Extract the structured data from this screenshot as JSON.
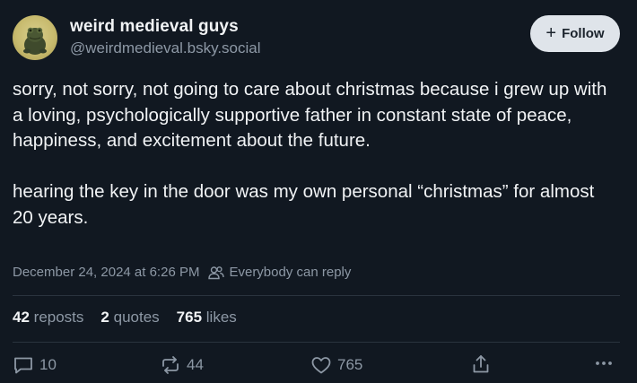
{
  "author": {
    "display_name": "weird medieval guys",
    "handle": "@weirdmedieval.bsky.social",
    "avatar_icon": "frog-avatar"
  },
  "follow_button": {
    "label": "Follow",
    "icon": "plus-icon"
  },
  "post": {
    "paragraphs": [
      "sorry, not sorry, not going to care about christmas because i grew up with a loving, psychologically supportive father in constant state of peace, happiness, and excitement about the future.",
      "hearing the key in the door was my own personal “christmas” for almost 20 years."
    ],
    "timestamp": "December 24, 2024 at 6:26 PM",
    "reply_setting": "Everybody can reply"
  },
  "stats": {
    "reposts": {
      "count": "42",
      "label": "reposts"
    },
    "quotes": {
      "count": "2",
      "label": "quotes"
    },
    "likes": {
      "count": "765",
      "label": "likes"
    }
  },
  "actions": {
    "reply": {
      "count": "10",
      "icon": "comment-icon"
    },
    "repost": {
      "count": "44",
      "icon": "repost-icon"
    },
    "like": {
      "count": "765",
      "icon": "heart-icon"
    },
    "share": {
      "icon": "share-icon"
    },
    "more": {
      "icon": "more-icon"
    }
  },
  "colors": {
    "background": "#111821",
    "text": "#f1f3f5",
    "muted": "#8d98a5",
    "follow_bg": "#dfe4ea"
  }
}
